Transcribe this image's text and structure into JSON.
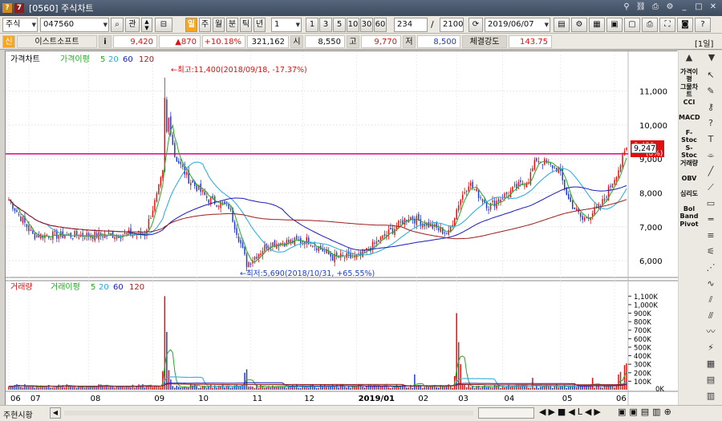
{
  "window": {
    "title": "[0560] 주식차트"
  },
  "toolbar": {
    "market": "주식",
    "code": "047560",
    "search_icon": "search-icon",
    "fav_label": "관",
    "periods": [
      "일",
      "주",
      "월",
      "분",
      "틱",
      "년"
    ],
    "interval_value": "1",
    "minute_buttons": [
      "1",
      "3",
      "5",
      "10",
      "30",
      "60"
    ],
    "count_value": "234",
    "total_value": "2100",
    "date_value": "2019/06/07"
  },
  "quote": {
    "badge": "신",
    "name": "이스트소프트",
    "info_icon": "i",
    "price": "9,420",
    "change": "▲870",
    "change_pct": "+10.18%",
    "volume": "321,162",
    "open_label": "시",
    "open": "8,550",
    "high_label": "고",
    "high": "9,770",
    "low_label": "저",
    "low": "8,500",
    "strength_label": "체결강도",
    "strength": "143.75",
    "period_tag": "[1일]"
  },
  "price_panel": {
    "legend_title": "가격차트",
    "legend_ma_label": "가격이평",
    "legend_ma": [
      "5",
      "20",
      "60",
      "120"
    ],
    "legend_colors": [
      "#22aa22",
      "#22aadd",
      "#1a1ab8",
      "#9b1c1c"
    ],
    "high_annotation": "←최고:11,400(2018/09/18, -17.37%)",
    "low_annotation": "←최저:5,690(2018/10/31, +65.55%)",
    "price_tag_current": "9,420",
    "price_tag_cursor": "9,247",
    "price_tag_pct": "(8%)"
  },
  "volume_panel": {
    "legend_title": "거래량",
    "legend_ma_label": "거래이평",
    "legend_ma": [
      "5",
      "20",
      "60",
      "120"
    ]
  },
  "x_axis": {
    "labels": [
      {
        "t": "06",
        "i": 0
      },
      {
        "t": "07",
        "i": 10
      },
      {
        "t": "08",
        "i": 40
      },
      {
        "t": "09",
        "i": 72
      },
      {
        "t": "10",
        "i": 94
      },
      {
        "t": "11",
        "i": 121
      },
      {
        "t": "12",
        "i": 147
      },
      {
        "t": "2019/01",
        "i": 174
      },
      {
        "t": "02",
        "i": 204
      },
      {
        "t": "03",
        "i": 224
      },
      {
        "t": "04",
        "i": 247
      },
      {
        "t": "05",
        "i": 276
      },
      {
        "t": "06",
        "i": 303
      }
    ]
  },
  "chart_data": [
    {
      "type": "candlestick",
      "title": "가격차트",
      "ylim": [
        5600,
        11700
      ],
      "yticks": [
        6000,
        7000,
        8000,
        9000,
        10000,
        11000
      ],
      "ytick_labels": [
        "6,000",
        "7,000",
        "8,000",
        "9,000",
        "10,000",
        "11,000"
      ],
      "reference_line": 9150,
      "anchors": [
        {
          "i": 0,
          "v": 7800
        },
        {
          "i": 12,
          "v": 6750
        },
        {
          "i": 45,
          "v": 6750
        },
        {
          "i": 68,
          "v": 6800
        },
        {
          "i": 74,
          "v": 7900
        },
        {
          "i": 78,
          "v": 8800
        },
        {
          "i": 80,
          "v": 10200
        },
        {
          "i": 83,
          "v": 9100
        },
        {
          "i": 90,
          "v": 8400
        },
        {
          "i": 100,
          "v": 7800
        },
        {
          "i": 110,
          "v": 7600
        },
        {
          "i": 116,
          "v": 6500
        },
        {
          "i": 119,
          "v": 5900
        },
        {
          "i": 130,
          "v": 6500
        },
        {
          "i": 150,
          "v": 6600
        },
        {
          "i": 162,
          "v": 6100
        },
        {
          "i": 175,
          "v": 6100
        },
        {
          "i": 200,
          "v": 7300
        },
        {
          "i": 220,
          "v": 6800
        },
        {
          "i": 225,
          "v": 7700
        },
        {
          "i": 230,
          "v": 8300
        },
        {
          "i": 240,
          "v": 7600
        },
        {
          "i": 260,
          "v": 8400
        },
        {
          "i": 264,
          "v": 9000
        },
        {
          "i": 275,
          "v": 8700
        },
        {
          "i": 280,
          "v": 7800
        },
        {
          "i": 287,
          "v": 7200
        },
        {
          "i": 296,
          "v": 7600
        },
        {
          "i": 305,
          "v": 8700
        },
        {
          "i": 309,
          "v": 9300
        }
      ]
    },
    {
      "type": "bar",
      "title": "거래량",
      "ylim": [
        0,
        1150
      ],
      "yticks": [
        100,
        200,
        300,
        400,
        500,
        600,
        700,
        800,
        900,
        1000,
        1100
      ],
      "ytick_labels": [
        "100K",
        "200K",
        "300K",
        "400K",
        "500K",
        "600K",
        "700K",
        "800K",
        "900K",
        "1,000K",
        "1,100K"
      ],
      "zero_label": "0K",
      "spikes": [
        {
          "i": 77,
          "v": 220
        },
        {
          "i": 78,
          "v": 1100
        },
        {
          "i": 79,
          "v": 680
        },
        {
          "i": 80,
          "v": 230
        },
        {
          "i": 81,
          "v": 120
        },
        {
          "i": 118,
          "v": 200
        },
        {
          "i": 119,
          "v": 240
        },
        {
          "i": 203,
          "v": 180
        },
        {
          "i": 223,
          "v": 160
        },
        {
          "i": 224,
          "v": 900
        },
        {
          "i": 225,
          "v": 560
        },
        {
          "i": 226,
          "v": 300
        },
        {
          "i": 262,
          "v": 140
        },
        {
          "i": 292,
          "v": 140
        },
        {
          "i": 305,
          "v": 180
        },
        {
          "i": 306,
          "v": 210
        },
        {
          "i": 308,
          "v": 290
        },
        {
          "i": 309,
          "v": 310
        }
      ]
    }
  ],
  "right_panel": {
    "indicators": [
      "가격이평",
      "그물차트",
      "CCI",
      "MACD",
      "F-Stoc",
      "S-Stoc",
      "거래량",
      "OBV",
      "심리도",
      "Bol Band",
      "Pivot"
    ]
  },
  "status": {
    "tab_label": "주현시황"
  }
}
